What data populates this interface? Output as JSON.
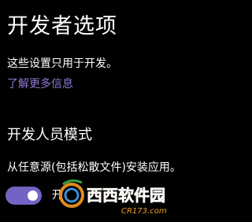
{
  "header": {
    "title": "开发者选项"
  },
  "intro": {
    "description": "这些设置只用于开发。",
    "link_label": "了解更多信息",
    "link_color": "#8f7ad6"
  },
  "developer_mode": {
    "title": "开发人员模式",
    "description": "从任意源(包括松散文件)安装应用。",
    "toggle_on": true,
    "toggle_label": "开",
    "accent_color": "#7463c4"
  },
  "watermark": {
    "text": "西西软件园",
    "url_text": "CR173.com"
  }
}
